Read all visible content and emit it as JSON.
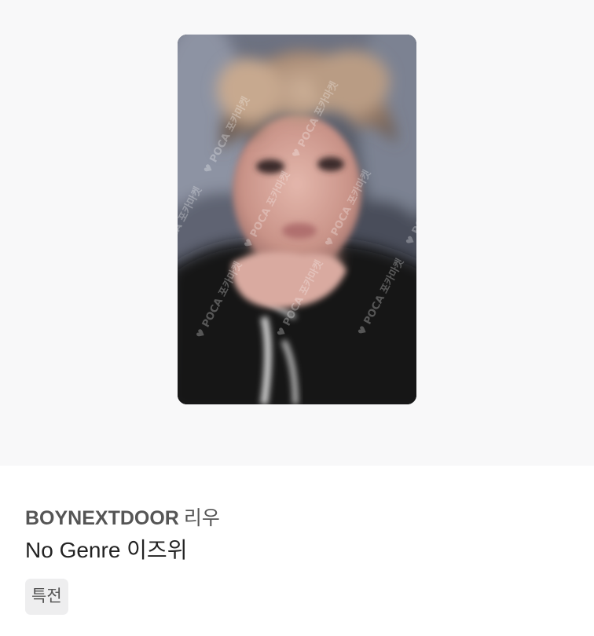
{
  "product": {
    "image_alt": "photocard",
    "watermark_text": "POCA 포카마켓",
    "artist_group": "BOYNEXTDOOR",
    "member_name": "리우",
    "album_name": "No Genre 이즈위",
    "badge_label": "특전"
  }
}
